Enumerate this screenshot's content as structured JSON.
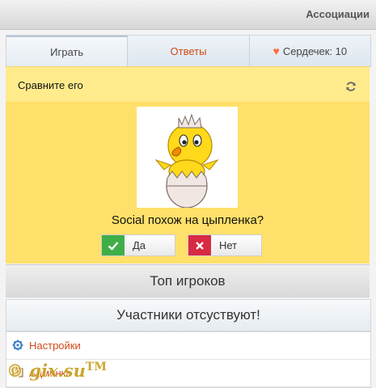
{
  "header": {
    "title": "Ассоциации"
  },
  "tabs": [
    {
      "label": "Играть"
    },
    {
      "label": "Ответы"
    },
    {
      "label": "Сердечек: 10"
    }
  ],
  "question": {
    "prompt": "Сравните его",
    "text": "Social похож на цыпленка?",
    "yes_label": "Да",
    "no_label": "Нет"
  },
  "top_players": {
    "title": "Топ игроков",
    "empty_text": "Участники отсуствуют!"
  },
  "menu": [
    {
      "label": "Настройки",
      "icon": "gear-icon"
    },
    {
      "label": "Админка",
      "icon": "book-icon"
    }
  ],
  "watermark": {
    "text": "© gix.su",
    "mark": "TM"
  },
  "colors": {
    "accent": "#d04a17",
    "yellow": "#ffe06a",
    "yes": "#3fae47",
    "no": "#d72a43"
  }
}
